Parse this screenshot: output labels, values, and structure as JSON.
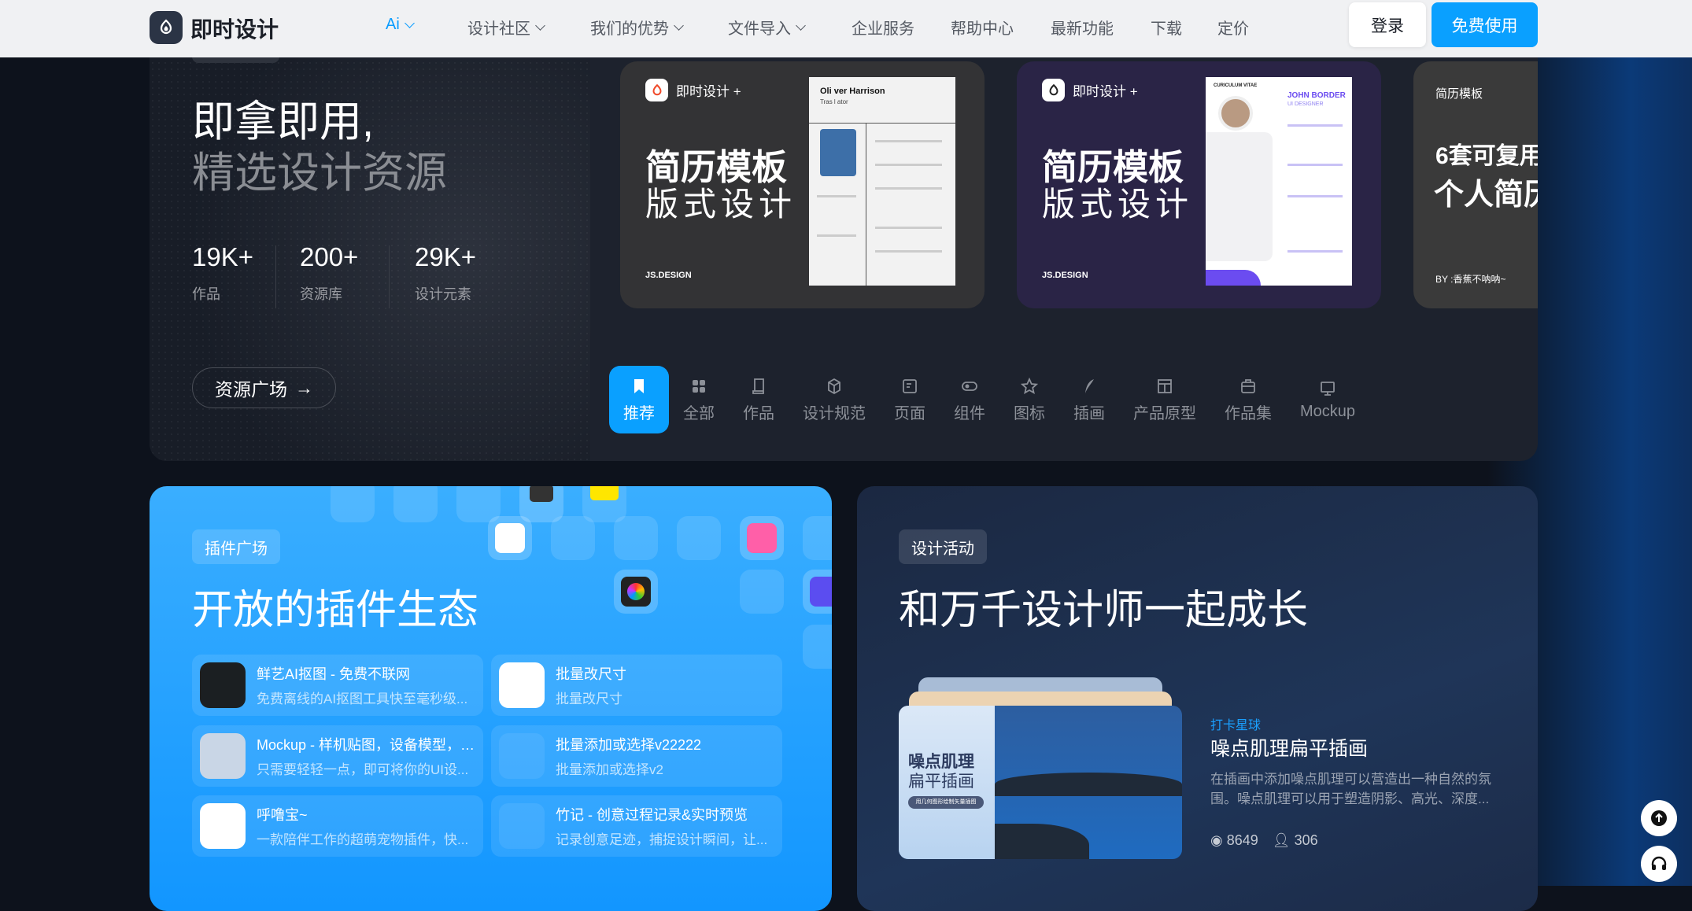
{
  "nav": {
    "brand": "即时设计",
    "items": [
      {
        "label": "Ai",
        "dropdown": true
      },
      {
        "label": "设计社区",
        "dropdown": true
      },
      {
        "label": "我们的优势",
        "dropdown": true
      },
      {
        "label": "文件导入",
        "dropdown": true
      },
      {
        "label": "企业服务",
        "dropdown": false
      },
      {
        "label": "帮助中心",
        "dropdown": false
      },
      {
        "label": "最新功能",
        "dropdown": false
      },
      {
        "label": "下载",
        "dropdown": false
      },
      {
        "label": "定价",
        "dropdown": false
      }
    ],
    "login": "登录",
    "free": "免费使用"
  },
  "hero": {
    "chip": "资源广场",
    "title1": "即拿即用,",
    "title2": "精选设计资源",
    "stats": [
      {
        "value": "19K+",
        "label": "作品"
      },
      {
        "value": "200+",
        "label": "资源库"
      },
      {
        "value": "29K+",
        "label": "设计元素"
      }
    ],
    "cta": "资源广场",
    "cards": [
      {
        "brand": "即时设计 +",
        "title": "简历模板",
        "subtitle": "版式设计",
        "footer": "JS.DESIGN",
        "resume_name": "Oli ver Harrison",
        "resume_role": "Tras l ator"
      },
      {
        "brand": "即时设计 +",
        "title": "简历模板",
        "subtitle": "版式设计",
        "footer": "JS.DESIGN",
        "resume_name": "JOHN BORDER",
        "resume_role": "UI DESIGNER",
        "resume_header": "CURICULUM VITAE"
      },
      {
        "tag": "简历模板",
        "title": "6套可复用",
        "subtitle": "个人简历",
        "footer": "BY :香蕉不呐呐~"
      }
    ],
    "tabs": [
      {
        "label": "推荐",
        "icon": "bookmark-icon",
        "active": true
      },
      {
        "label": "全部",
        "icon": "grid-icon"
      },
      {
        "label": "作品",
        "icon": "scroll-icon"
      },
      {
        "label": "设计规范",
        "icon": "cube-icon"
      },
      {
        "label": "页面",
        "icon": "page-icon"
      },
      {
        "label": "组件",
        "icon": "component-icon"
      },
      {
        "label": "图标",
        "icon": "star-icon"
      },
      {
        "label": "插画",
        "icon": "feather-icon"
      },
      {
        "label": "产品原型",
        "icon": "layout-icon"
      },
      {
        "label": "作品集",
        "icon": "briefcase-icon"
      },
      {
        "label": "Mockup",
        "icon": "monitor-icon"
      }
    ]
  },
  "plugins": {
    "chip": "插件广场",
    "title": "开放的插件生态",
    "items": [
      {
        "name": "鲜艺AI抠图 - 免费不联网",
        "desc": "免费离线的AI抠图工具快至毫秒级..."
      },
      {
        "name": "批量改尺寸",
        "desc": "批量改尺寸"
      },
      {
        "name": "Mockup - 样机贴图，设备模型，产品宣传",
        "desc": "只需要轻轻一点，即可将你的UI设..."
      },
      {
        "name": "批量添加或选择v22222",
        "desc": "批量添加或选择v2"
      },
      {
        "name": "呼噜宝~",
        "desc": "一款陪伴工作的超萌宠物插件，快..."
      },
      {
        "name": "竹记 - 创意过程记录&实时预览",
        "desc": "记录创意足迹，捕捉设计瞬间，让..."
      }
    ]
  },
  "activity": {
    "chip": "设计活动",
    "title": "和万千设计师一起成长",
    "cover_title1": "噪点肌理",
    "cover_title2": "扁平插画",
    "cover_tag": "用几何图形绘制矢量插图",
    "category": "打卡星球",
    "name": "噪点肌理扁平插画",
    "desc": "在插画中添加噪点肌理可以营造出一种自然的氛围。噪点肌理可以用于塑造阴影、高光、深度...",
    "views": "8649",
    "users": "306"
  },
  "colors": {
    "accent": "#0aa0ff",
    "nav_bg": "#f0f1f3",
    "page_bg": "#0d121c"
  }
}
